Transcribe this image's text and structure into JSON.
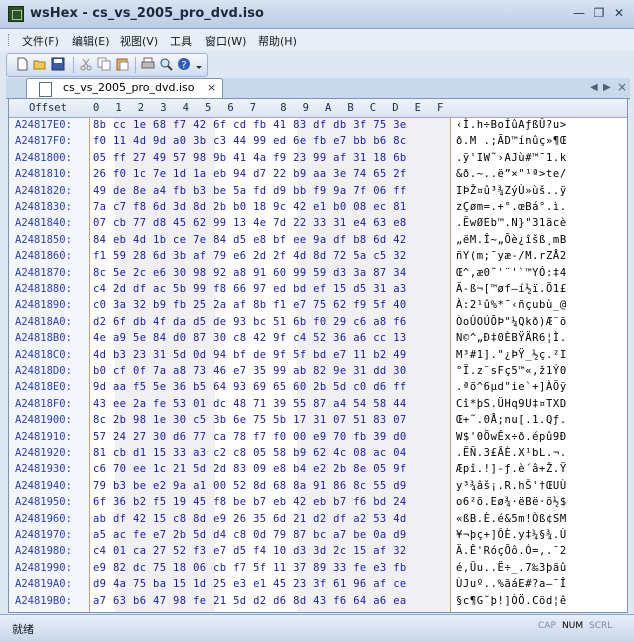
{
  "window": {
    "title": "wsHex - cs_vs_2005_pro_dvd.iso",
    "minimize": "—",
    "restore": "❐",
    "close": "✕"
  },
  "menu": [
    "文件(F)",
    "编辑(E)",
    "视图(V)",
    "工具",
    "窗口(W)",
    "帮助(H)"
  ],
  "toolbar": {
    "icons": [
      "new-file-icon",
      "open-folder-icon",
      "save-icon",
      "cut-icon",
      "copy-icon",
      "paste-icon",
      "print-icon",
      "help-icon",
      "toolbar-options-icon"
    ]
  },
  "tab": {
    "label": "cs_vs_2005_pro_dvd.iso",
    "close": "×",
    "prev": "◀",
    "next": "▶",
    "close_all": "×"
  },
  "header": {
    "offset": "Offset",
    "columns": [
      "0",
      "1",
      "2",
      "3",
      "4",
      "5",
      "6",
      "7",
      "8",
      "9",
      "A",
      "B",
      "C",
      "D",
      "E",
      "F"
    ]
  },
  "rows": [
    {
      "off": "A24817E0:",
      "hex": "8b cc 1e 68 f7 42 6f cd fb 41 83 df db 3f 75 3e",
      "asc": "‹Ì.h÷BoÍûAƒßÛ?u>"
    },
    {
      "off": "A24817F0:",
      "hex": "f0 11 4d 9d a0 3b c3 44 99 ed 6e fb e7 bb b6 8c",
      "asc": "ð.M .;ÃD™ínûç»¶Œ"
    },
    {
      "off": "A2481800:",
      "hex": "05 ff 27 49 57 98 9b 41 4a f9 23 99 af 31 18 6b",
      "asc": ".ÿ'IW˜›AJù#™¯1.k"
    },
    {
      "off": "A2481810:",
      "hex": "26 f0 1c 7e 1d 1a eb 94 d7 22 b9 aa 3e 74 65 2f",
      "asc": "&ð.~..ë”×\"¹ª>te/"
    },
    {
      "off": "A2481820:",
      "hex": "49 de 8e a4 fb b3 be 5a fd d9 bb f9 9a 7f 06 ff",
      "asc": "IÞŽ¤û³¾ZýÙ»ùš..ÿ"
    },
    {
      "off": "A2481830:",
      "hex": "7a c7 f8 6d 3d 8d 2b b0 18 9c 42 e1 b0 08 ec 81",
      "asc": "zÇøm=.+°.œBá°.ì."
    },
    {
      "off": "A2481840:",
      "hex": "07 cb 77 d8 45 62 99 13 4e 7d 22 33 31 e4 63 e8",
      "asc": ".ËwØEb™.N}\"31äcè"
    },
    {
      "off": "A2481850:",
      "hex": "84 eb 4d 1b ce 7e 84 d5 e8 bf ee 9a df b8 6d 42",
      "asc": "„ëM.Î~„Õè¿îšß¸mB"
    },
    {
      "off": "A2481860:",
      "hex": "f1 59 28 6d 3b af 79 e6 2d 2f 4d 8d 72 5a c5 32",
      "asc": "ñY(m;¯yæ-/M.rZÅ2"
    },
    {
      "off": "A2481870:",
      "hex": "8c 5e 2c e6 30 98 92 a8 91 60 99 59 d3 3a 87 34",
      "asc": "Œ^,æ0˜'¨'`™YÓ:‡4"
    },
    {
      "off": "A2481880:",
      "hex": "c4 2d df ac 5b 99 f8 66 97 ed bd ef 15 d5 31 a3",
      "asc": "Ä-ß¬[™øf—í½ï.Õ1£"
    },
    {
      "off": "A2481890:",
      "hex": "c0 3a 32 b9 fb 25 2a af 8b f1 e7 75 62 f9 5f 40",
      "asc": "À:2¹û%*¯‹ñçubù_@"
    },
    {
      "off": "A24818A0:",
      "hex": "d2 6f db 4f da d5 de 93 bc 51 6b f0 29 c6 a8 f6",
      "asc": "ÒoÛOÚÕÞ\"¼Qkð)Æ¨ö"
    },
    {
      "off": "A24818B0:",
      "hex": "4e a9 5e 84 d0 87 30 c8 42 9f c4 52 36 a6 cc 13",
      "asc": "N©^„Ð‡0ÈBŸÄR6¦Ì."
    },
    {
      "off": "A24818C0:",
      "hex": "4d b3 23 31 5d 0d 94 bf de 9f 5f bd e7 11 b2 49",
      "asc": "M³#1].\"¿ÞŸ_½ç.²I"
    },
    {
      "off": "A24818D0:",
      "hex": "b0 cf 0f 7a a8 73 46 e7 35 99 ab 82 9e 31 dd 30",
      "asc": "°Ï.z¨sFç5™«‚ž1Ý0"
    },
    {
      "off": "A24818E0:",
      "hex": "9d aa f5 5e 36 b5 64 93 69 65 60 2b 5d c0 d6 ff",
      "asc": ".ªõ^6µd\"ie`+]ÀÖÿ"
    },
    {
      "off": "A24818F0:",
      "hex": "43 ee 2a fe 53 01 dc 48 71 39 55 87 a4 54 58 44",
      "asc": "Cî*þS.ÜHq9U‡¤TXD"
    },
    {
      "off": "A2481900:",
      "hex": "8c 2b 98 1e 30 c5 3b 6e 75 5b 17 31 07 51 83 07",
      "asc": "Œ+˜.0Å;nu[.1.Qƒ."
    },
    {
      "off": "A2481910:",
      "hex": "57 24 27 30 d6 77 ca 78 f7 f0 00 e9 70 fb 39 d0",
      "asc": "W$'0ÖwÊx÷ð.épû9Ð"
    },
    {
      "off": "A2481920:",
      "hex": "81 cb d1 15 33 a3 c2 c8 05 58 b9 62 4c 08 ac 04",
      "asc": ".ËÑ.3£ÂÈ.X¹bL.¬."
    },
    {
      "off": "A2481930:",
      "hex": "c6 70 ee 1c 21 5d 2d 83 09 e8 b4 e2 2b 8e 05 9f",
      "asc": "Æpî.!]-ƒ.è´â+Ž.Ÿ"
    },
    {
      "off": "A2481940:",
      "hex": "79 b3 be e2 9a a1 00 52 8d 68 8a 91 86 8c 55 d9",
      "asc": "y³¾âš¡.R.hŠ'†ŒUÙ"
    },
    {
      "off": "A2481950:",
      "hex": "6f 36 b2 f5 19 45 f8 be b7 eb 42 eb b7 f6 bd 24",
      "asc": "o6²õ.Eø¾·ëBë·ö½$"
    },
    {
      "off": "A2481960:",
      "hex": "ab df 42 15 c8 8d e9 26 35 6d 21 d2 df a2 53 4d",
      "asc": "«ßB.È.é&5m!Òß¢SM"
    },
    {
      "off": "A2481970:",
      "hex": "a5 ac fe e7 2b 5d d4 c8 0d 79 87 bc a7 be 0a d9",
      "asc": "¥¬þç+]ÔÈ.y‡¼§¾.Ù"
    },
    {
      "off": "A2481980:",
      "hex": "c4 01 ca 27 52 f3 e7 d5 f4 10 d3 3d 2c 15 af 32",
      "asc": "Ä.Ê'RóçÕô.Ó=,.¯2"
    },
    {
      "off": "A2481990:",
      "hex": "e9 82 dc 75 18 06 cb f7 5f 11 37 89 33 fe e3 fb",
      "asc": "é‚Üu..Ë÷_.7‰3þãû"
    },
    {
      "off": "A24819A0:",
      "hex": "d9 4a 75 ba 15 1d 25 e3 e1 45 23 3f 61 96 af ce",
      "asc": "ÙJuº..%ãáE#?a–¯Î"
    },
    {
      "off": "A24819B0:",
      "hex": "a7 63 b6 47 98 fe 21 5d d2 d6 8d 43 f6 64 a6 ea",
      "asc": "§c¶G˜þ!]ÒÖ.Cöd¦ê"
    }
  ],
  "status": {
    "text": "就绪",
    "indicators": [
      "CAP",
      "NUM",
      "SCRL"
    ]
  }
}
